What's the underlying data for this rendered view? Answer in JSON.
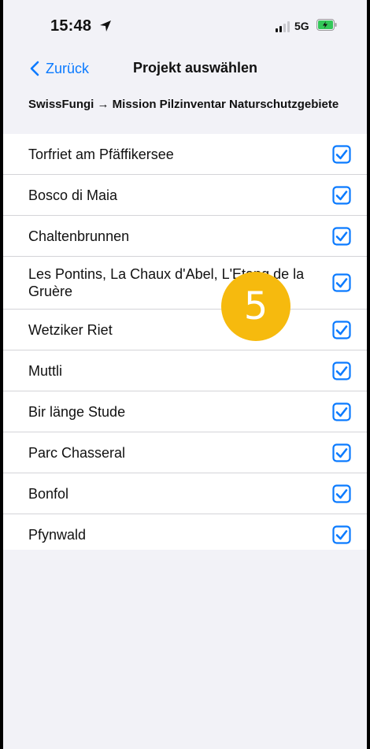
{
  "status_bar": {
    "time": "15:48",
    "network": "5G",
    "icons": [
      "location-arrow-icon",
      "signal-icon",
      "battery-charging-icon"
    ]
  },
  "nav": {
    "back_label": "Zurück",
    "title": "Projekt auswählen"
  },
  "section": {
    "header": "SwissFungi → Mission Pilzinventar Naturschutzgebiete"
  },
  "projects": [
    {
      "label": "Torfriet am Pfäffikersee",
      "checked": true
    },
    {
      "label": "Bosco di Maia",
      "checked": true
    },
    {
      "label": "Chaltenbrunnen",
      "checked": true
    },
    {
      "label": "Les Pontins, La Chaux d'Abel, L'Etang de la Gruère",
      "checked": true
    },
    {
      "label": "Wetziker Riet",
      "checked": true
    },
    {
      "label": "Muttli",
      "checked": true
    },
    {
      "label": "Bir länge Stude",
      "checked": true
    },
    {
      "label": "Parc Chasseral",
      "checked": true
    },
    {
      "label": "Bonfol",
      "checked": true
    },
    {
      "label": "Pfynwald",
      "checked": true
    }
  ],
  "overlay": {
    "step_number": "5"
  },
  "colors": {
    "accent": "#0a7aff",
    "badge": "#f6ba0e",
    "background": "#f2f2f7"
  }
}
